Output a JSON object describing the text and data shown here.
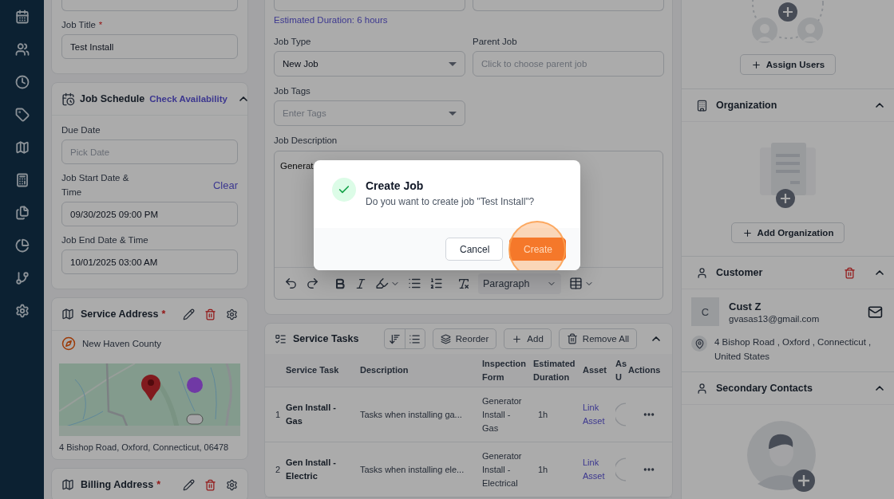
{
  "job_details": {
    "title_label": "Job Title",
    "required_mark": "*",
    "title_value": "Test Install"
  },
  "job_schedule": {
    "title": "Job Schedule",
    "link": "Check Availability",
    "expanded": true,
    "fields": [
      {
        "label": "Due Date",
        "placeholder": "Pick Date"
      },
      {
        "label": "Job Start Date & Time",
        "value": "09/30/2025 09:00 PM",
        "action": "Clear"
      },
      {
        "label": "Job End Date & Time",
        "value": "10/01/2025 03:00 AM"
      }
    ]
  },
  "service_address": {
    "title": "Service Address",
    "required_mark": "*",
    "region": "New Haven County",
    "address": "4 Bishop Road, Oxford, Connecticut, 06478"
  },
  "billing_address": {
    "title": "Billing Address",
    "required_mark": "*"
  },
  "job_form": {
    "estimated_duration": "Estimated Duration: 6 hours",
    "fields": [
      {
        "label": "Job Type",
        "value": "New Job",
        "kind": "select"
      },
      {
        "label": "Parent Job",
        "placeholder": "Click to choose parent job",
        "kind": "input"
      },
      {
        "label": "Job Tags",
        "placeholder": "Enter Tags",
        "kind": "select"
      }
    ],
    "description": {
      "label": "Job Description",
      "text": "Generat",
      "format": "Paragraph"
    }
  },
  "service_tasks": {
    "title": "Service Tasks",
    "expanded": true,
    "buttons": [
      "Reorder",
      "Add",
      "Remove All"
    ],
    "columns": [
      "",
      "Service Task",
      "Description",
      "Inspection Form",
      "Estimated Duration",
      "Asset",
      "As U",
      "Actions"
    ],
    "rows": [
      {
        "number": "1",
        "task": "Gen Install - Gas",
        "description": "Tasks when installing ga...",
        "form": "Generator Install - Gas",
        "duration": "1h",
        "asset": "Link Asset"
      },
      {
        "number": "2",
        "task": "Gen Install - Electric",
        "description": "Tasks when installing ele...",
        "form": "Generator Install - Electrical",
        "duration": "1h",
        "asset": "Link Asset"
      }
    ]
  },
  "assigned_users": {
    "button": "Assign Users"
  },
  "organization": {
    "title": "Organization",
    "expanded": true,
    "button": "Add Organization"
  },
  "customer": {
    "title": "Customer",
    "expanded": true,
    "initial": "C",
    "name": "Cust Z",
    "email": "gvasas13@gmail.com",
    "address": "4 Bishop Road , Oxford , Connecticut , United States"
  },
  "secondary_contacts": {
    "title": "Secondary Contacts",
    "expanded": true
  },
  "dialog": {
    "title": "Create Job",
    "message": "Do you want to create job \"Test Install\"?",
    "buttons": [
      {
        "label": "Cancel",
        "kind": "secondary",
        "highlighted": false
      },
      {
        "label": "Create",
        "kind": "primary",
        "highlighted": true
      }
    ]
  }
}
